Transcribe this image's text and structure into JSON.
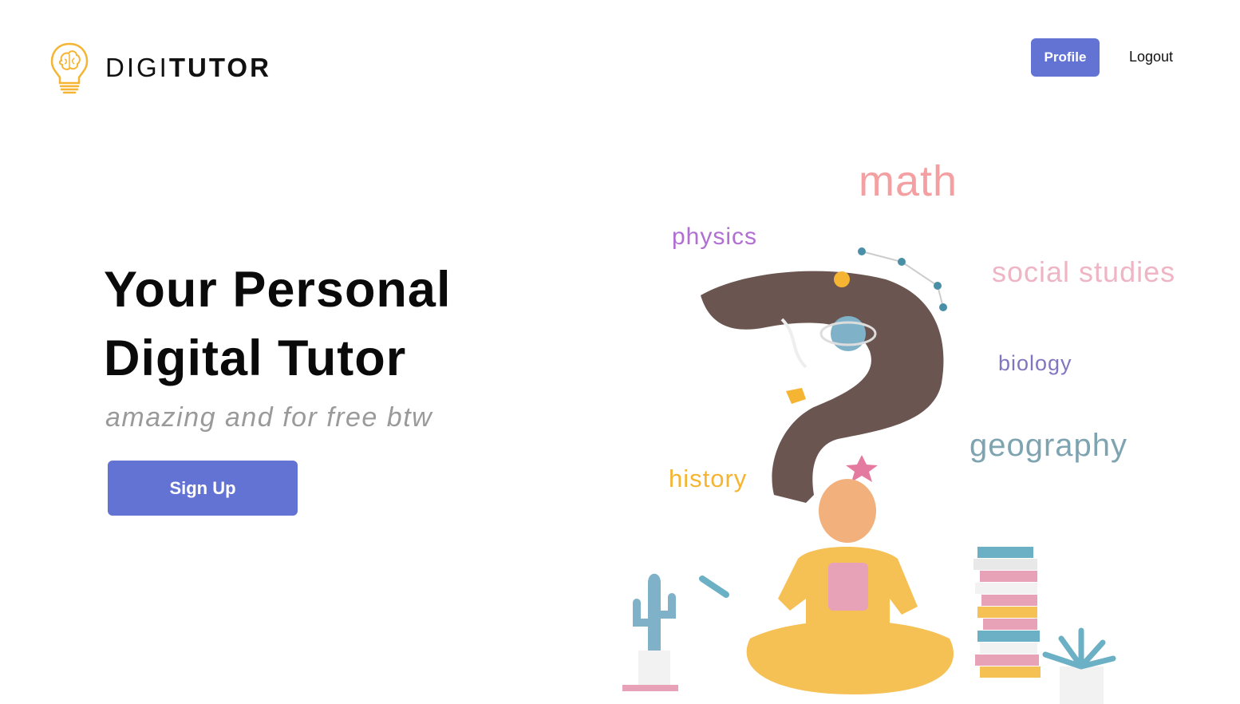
{
  "brand": {
    "light": "DIGI",
    "bold": "TUTOR"
  },
  "nav": {
    "profile": "Profile",
    "logout": "Logout"
  },
  "hero": {
    "title_line1": "Your Personal",
    "title_line2": "Digital Tutor",
    "subtitle": "amazing and for free btw",
    "cta": "Sign Up"
  },
  "subjects": {
    "math": "math",
    "physics": "physics",
    "social": "social studies",
    "biology": "biology",
    "geography": "geography",
    "history": "history"
  },
  "colors": {
    "accent": "#6373d4",
    "math": "#f4a0a2",
    "physics": "#b06fd1",
    "social": "#efb5c5",
    "biology": "#8275c0",
    "geography": "#7ea4b1",
    "history": "#f5b432",
    "logo": "#f5b432"
  },
  "icons": {
    "logo": "lightbulb-brain-icon",
    "illustration": "person-with-tablet-illustration"
  }
}
